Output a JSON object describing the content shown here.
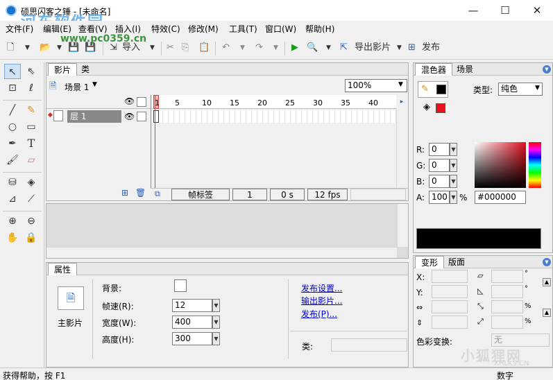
{
  "window": {
    "title": "硕思闪客之锤 - [未命名]",
    "controls": {
      "minimize": "—",
      "maximize": "☐",
      "close": "✕"
    }
  },
  "watermark": {
    "line1": "河东软件园",
    "line2": "www.pc0359.cn",
    "corner_brand": "小狐狸网",
    "corner_url": "XHLKS.CN"
  },
  "menu": [
    "文件(F)",
    "编辑(E)",
    "查看(V)",
    "插入(I)",
    "特效(C)",
    "修改(M)",
    "工具(T)",
    "窗口(W)",
    "帮助(H)"
  ],
  "toolbar": {
    "import_label": "导入",
    "export_movie_label": "导出影片",
    "publish_label": "发布"
  },
  "timeline": {
    "tabs": [
      "影片",
      "类"
    ],
    "scene_label": "场景 1",
    "zoom": "100%",
    "layer_name": "层 1",
    "frame_ticks": [
      "1",
      "5",
      "10",
      "15",
      "20",
      "25",
      "30",
      "35",
      "40"
    ],
    "frame_label_field": "帧标签",
    "current_frame": "1",
    "time": "0 s",
    "fps": "12 fps"
  },
  "properties": {
    "tab": "属性",
    "main_movie_label": "主影片",
    "background_label": "背景:",
    "frame_rate_label": "帧速(R):",
    "frame_rate_value": "12",
    "width_label": "宽度(W):",
    "width_value": "400",
    "height_label": "高度(H):",
    "height_value": "300",
    "links": [
      "发布设置...",
      "输出影片...",
      "发布(P)..."
    ],
    "class_label": "类:"
  },
  "mixer": {
    "tabs": [
      "混色器",
      "场景"
    ],
    "type_label": "类型:",
    "type_value": "纯色",
    "r_label": "R:",
    "r_value": "0",
    "g_label": "G:",
    "g_value": "0",
    "b_label": "B:",
    "b_value": "0",
    "a_label": "A:",
    "a_value": "100",
    "a_unit": "%",
    "hex_value": "#000000",
    "colors": {
      "stroke": "#000000",
      "fill": "#e8141c",
      "preview": "#000000"
    }
  },
  "transform": {
    "tabs": [
      "变形",
      "版面"
    ],
    "x_label": "X:",
    "y_label": "Y:",
    "pct": "%",
    "deg": "°",
    "color_transform_label": "色彩变换:",
    "color_transform_value": "无"
  },
  "status": {
    "left": "获得帮助，按 F1",
    "right": "数字"
  }
}
